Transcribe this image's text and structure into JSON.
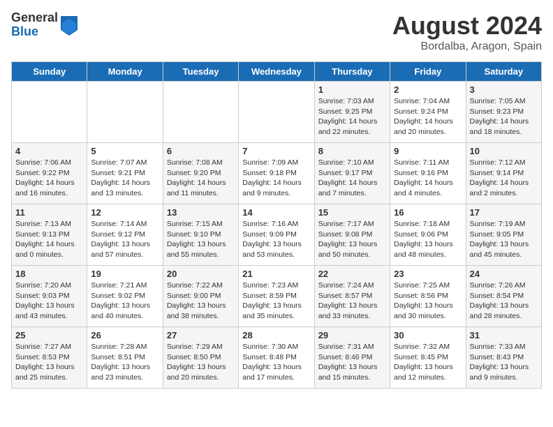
{
  "header": {
    "logo": {
      "general": "General",
      "blue": "Blue"
    },
    "title": "August 2024",
    "location": "Bordalba, Aragon, Spain"
  },
  "weekdays": [
    "Sunday",
    "Monday",
    "Tuesday",
    "Wednesday",
    "Thursday",
    "Friday",
    "Saturday"
  ],
  "weeks": [
    [
      null,
      null,
      null,
      null,
      {
        "day": "1",
        "sunrise": "7:03 AM",
        "sunset": "9:25 PM",
        "daylight": "14 hours and 22 minutes."
      },
      {
        "day": "2",
        "sunrise": "7:04 AM",
        "sunset": "9:24 PM",
        "daylight": "14 hours and 20 minutes."
      },
      {
        "day": "3",
        "sunrise": "7:05 AM",
        "sunset": "9:23 PM",
        "daylight": "14 hours and 18 minutes."
      }
    ],
    [
      {
        "day": "4",
        "sunrise": "7:06 AM",
        "sunset": "9:22 PM",
        "daylight": "14 hours and 16 minutes."
      },
      {
        "day": "5",
        "sunrise": "7:07 AM",
        "sunset": "9:21 PM",
        "daylight": "14 hours and 13 minutes."
      },
      {
        "day": "6",
        "sunrise": "7:08 AM",
        "sunset": "9:20 PM",
        "daylight": "14 hours and 11 minutes."
      },
      {
        "day": "7",
        "sunrise": "7:09 AM",
        "sunset": "9:18 PM",
        "daylight": "14 hours and 9 minutes."
      },
      {
        "day": "8",
        "sunrise": "7:10 AM",
        "sunset": "9:17 PM",
        "daylight": "14 hours and 7 minutes."
      },
      {
        "day": "9",
        "sunrise": "7:11 AM",
        "sunset": "9:16 PM",
        "daylight": "14 hours and 4 minutes."
      },
      {
        "day": "10",
        "sunrise": "7:12 AM",
        "sunset": "9:14 PM",
        "daylight": "14 hours and 2 minutes."
      }
    ],
    [
      {
        "day": "11",
        "sunrise": "7:13 AM",
        "sunset": "9:13 PM",
        "daylight": "14 hours and 0 minutes."
      },
      {
        "day": "12",
        "sunrise": "7:14 AM",
        "sunset": "9:12 PM",
        "daylight": "13 hours and 57 minutes."
      },
      {
        "day": "13",
        "sunrise": "7:15 AM",
        "sunset": "9:10 PM",
        "daylight": "13 hours and 55 minutes."
      },
      {
        "day": "14",
        "sunrise": "7:16 AM",
        "sunset": "9:09 PM",
        "daylight": "13 hours and 53 minutes."
      },
      {
        "day": "15",
        "sunrise": "7:17 AM",
        "sunset": "9:08 PM",
        "daylight": "13 hours and 50 minutes."
      },
      {
        "day": "16",
        "sunrise": "7:18 AM",
        "sunset": "9:06 PM",
        "daylight": "13 hours and 48 minutes."
      },
      {
        "day": "17",
        "sunrise": "7:19 AM",
        "sunset": "9:05 PM",
        "daylight": "13 hours and 45 minutes."
      }
    ],
    [
      {
        "day": "18",
        "sunrise": "7:20 AM",
        "sunset": "9:03 PM",
        "daylight": "13 hours and 43 minutes."
      },
      {
        "day": "19",
        "sunrise": "7:21 AM",
        "sunset": "9:02 PM",
        "daylight": "13 hours and 40 minutes."
      },
      {
        "day": "20",
        "sunrise": "7:22 AM",
        "sunset": "9:00 PM",
        "daylight": "13 hours and 38 minutes."
      },
      {
        "day": "21",
        "sunrise": "7:23 AM",
        "sunset": "8:59 PM",
        "daylight": "13 hours and 35 minutes."
      },
      {
        "day": "22",
        "sunrise": "7:24 AM",
        "sunset": "8:57 PM",
        "daylight": "13 hours and 33 minutes."
      },
      {
        "day": "23",
        "sunrise": "7:25 AM",
        "sunset": "8:56 PM",
        "daylight": "13 hours and 30 minutes."
      },
      {
        "day": "24",
        "sunrise": "7:26 AM",
        "sunset": "8:54 PM",
        "daylight": "13 hours and 28 minutes."
      }
    ],
    [
      {
        "day": "25",
        "sunrise": "7:27 AM",
        "sunset": "8:53 PM",
        "daylight": "13 hours and 25 minutes."
      },
      {
        "day": "26",
        "sunrise": "7:28 AM",
        "sunset": "8:51 PM",
        "daylight": "13 hours and 23 minutes."
      },
      {
        "day": "27",
        "sunrise": "7:29 AM",
        "sunset": "8:50 PM",
        "daylight": "13 hours and 20 minutes."
      },
      {
        "day": "28",
        "sunrise": "7:30 AM",
        "sunset": "8:48 PM",
        "daylight": "13 hours and 17 minutes."
      },
      {
        "day": "29",
        "sunrise": "7:31 AM",
        "sunset": "8:46 PM",
        "daylight": "13 hours and 15 minutes."
      },
      {
        "day": "30",
        "sunrise": "7:32 AM",
        "sunset": "8:45 PM",
        "daylight": "13 hours and 12 minutes."
      },
      {
        "day": "31",
        "sunrise": "7:33 AM",
        "sunset": "8:43 PM",
        "daylight": "13 hours and 9 minutes."
      }
    ]
  ]
}
